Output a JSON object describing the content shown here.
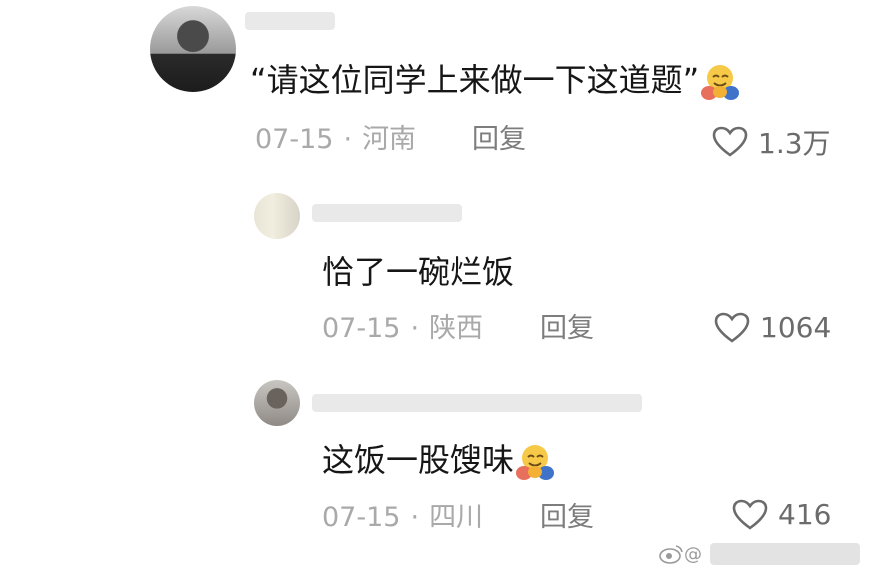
{
  "comments": [
    {
      "text": "“请这位同学上来做一下这道题”",
      "date": "07-15",
      "location": "河南",
      "reply_label": "回复",
      "likes": "1.3万",
      "emoji": "hugging-face"
    },
    {
      "text": "恰了一碗烂饭",
      "date": "07-15",
      "location": "陕西",
      "reply_label": "回复",
      "likes": "1064"
    },
    {
      "text": "这饭一股馊味",
      "date": "07-15",
      "location": "四川",
      "reply_label": "回复",
      "likes": "416",
      "emoji": "hugging-face"
    }
  ],
  "colors": {
    "text": "#161616",
    "meta": "#a9a9a9",
    "reply": "#7d7d7d",
    "like": "#6b6b6b",
    "emoji_face": "#f7c948",
    "emoji_hands": "#e86f5b"
  }
}
